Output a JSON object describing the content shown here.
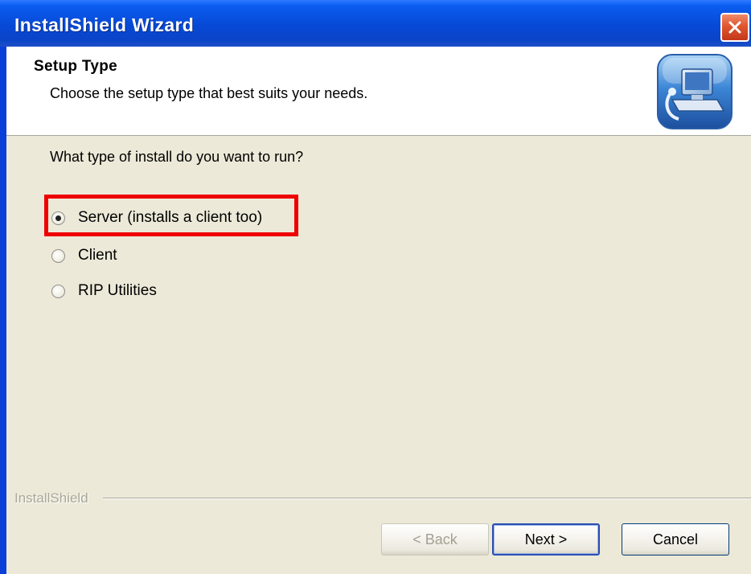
{
  "window": {
    "title": "InstallShield Wizard",
    "close_icon": "close-icon"
  },
  "header": {
    "title": "Setup Type",
    "subtitle": "Choose the setup type that best suits your needs.",
    "icon": "computer-setup-icon"
  },
  "body": {
    "question": "What type of install do you want to run?",
    "options": [
      {
        "label": "Server (installs a client too)",
        "selected": true
      },
      {
        "label": "Client",
        "selected": false
      },
      {
        "label": "RIP Utilities",
        "selected": false
      }
    ],
    "highlight_color": "#ef0000"
  },
  "footer": {
    "brand": "InstallShield",
    "back_label": "< Back",
    "next_label": "Next >",
    "cancel_label": "Cancel"
  },
  "colors": {
    "titlebar": "#0749d6",
    "body_bg": "#ece9d8",
    "header_bg": "#ffffff"
  }
}
